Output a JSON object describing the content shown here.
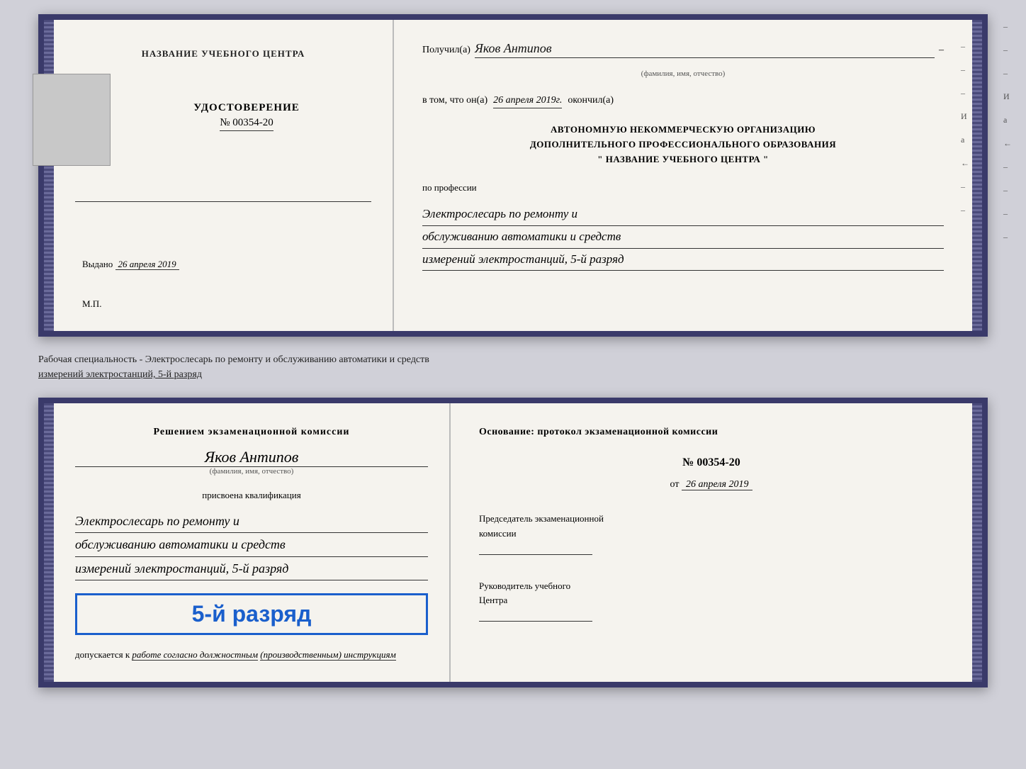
{
  "top_doc": {
    "left": {
      "center_label": "НАЗВАНИЕ УЧЕБНОГО ЦЕНТРА",
      "udostoverenie_title": "УДОСТОВЕРЕНИЕ",
      "number": "№ 00354-20",
      "vydano_label": "Выдано",
      "vydano_date": "26 апреля 2019",
      "mp_label": "М.П."
    },
    "right": {
      "poluchil_label": "Получил(а)",
      "recipient_name": "Яков Антипов",
      "fio_sub": "(фамилия, имя, отчество)",
      "dash": "–",
      "vtom_label": "в том, что он(а)",
      "vtom_date": "26 апреля 2019г.",
      "okончил_label": "окончил(а)",
      "org_line1": "АВТОНОМНУЮ НЕКОММЕРЧЕСКУЮ ОРГАНИЗАЦИЮ",
      "org_line2": "ДОПОЛНИТЕЛЬНОГО ПРОФЕССИОНАЛЬНОГО ОБРАЗОВАНИЯ",
      "org_line3": "\"   НАЗВАНИЕ УЧЕБНОГО ЦЕНТРА   \"",
      "po_professii": "по профессии",
      "profession_line1": "Электрослесарь по ремонту и",
      "profession_line2": "обслуживанию автоматики и средств",
      "profession_line3": "измерений электростанций, 5-й разряд"
    }
  },
  "separator": {
    "text_line1": "Рабочая специальность - Электрослесарь по ремонту и обслуживанию автоматики и средств",
    "text_line2": "измерений электростанций, 5-й разряд"
  },
  "bottom_doc": {
    "left": {
      "resheniem": "Решением экзаменационной комиссии",
      "person_name": "Яков Антипов",
      "fio_sub": "(фамилия, имя, отчество)",
      "prisvoena": "присвоена квалификация",
      "qual_line1": "Электрослесарь по ремонту и",
      "qual_line2": "обслуживанию автоматики и средств",
      "qual_line3": "измерений электростанций, 5-й разряд",
      "razryad_label": "5-й разряд",
      "dopuskaetsya": "допускается к",
      "dopusk_text": "работе согласно должностным",
      "instruktsiya": "(производственным) инструкциям"
    },
    "right": {
      "osnovanie": "Основание: протокол экзаменационной комиссии",
      "number_label": "№ 00354-20",
      "ot_label": "от",
      "ot_date": "26 апреля 2019",
      "predsedatel_line1": "Председатель экзаменационной",
      "predsedatel_line2": "комиссии",
      "rukovoditel_line1": "Руководитель учебного",
      "rukovoditel_line2": "Центра"
    }
  },
  "side_marks": {
    "items": [
      "–",
      "–",
      "–",
      "И",
      "а",
      "←",
      "–",
      "–",
      "–",
      "–"
    ]
  }
}
